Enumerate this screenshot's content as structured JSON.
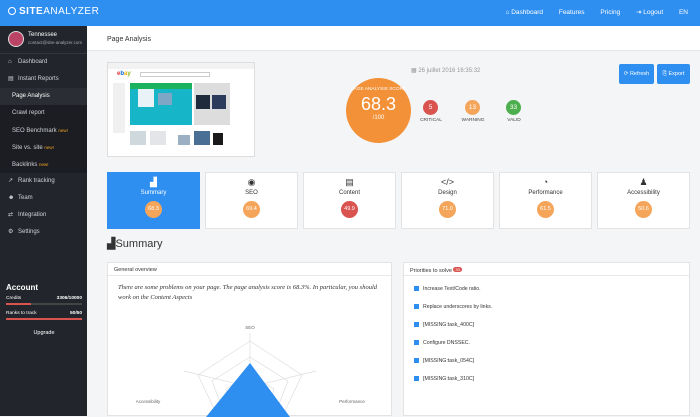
{
  "brand": {
    "site": "SITE",
    "analyzer": "ANALYZER"
  },
  "nav": {
    "dashboard": "Dashboard",
    "features": "Features",
    "pricing": "Pricing",
    "logout": "Logout",
    "lang": "EN"
  },
  "user": {
    "name": "Tennessee",
    "email": "contact@site-analyzer.com"
  },
  "sidebar": {
    "dashboard": "Dashboard",
    "instant": "Instant Reports",
    "subs": [
      "Page Analysis",
      "Crawl report",
      "SEO Benchmark",
      "Site vs. site",
      "Backlinks"
    ],
    "new": "new!",
    "rank": "Rank tracking",
    "team": "Team",
    "integration": "Integration",
    "settings": "Settings"
  },
  "account": {
    "title": "Account",
    "credits_label": "Credits",
    "credits_value": "3306/10000",
    "ranks_label": "Ranks to track",
    "ranks_value": "50/50",
    "credits_pct": 33,
    "ranks_pct": 100,
    "upgrade": "Upgrade"
  },
  "page_title": "Page Analysis",
  "analysis": {
    "date": "26 juillet 2016 16:35:32",
    "score_label": "PAGE ANALYSIS SCORE",
    "score": "68.3",
    "score_max": "/100",
    "critical": {
      "value": "5",
      "label": "CRITICAL"
    },
    "warning": {
      "value": "13",
      "label": "WARNING"
    },
    "valid": {
      "value": "33",
      "label": "VALID"
    }
  },
  "buttons": {
    "refresh": "Refresh",
    "export": "Export"
  },
  "categories": [
    {
      "label": "Summary",
      "score": "68.3",
      "icon": "chart-icon"
    },
    {
      "label": "SEO",
      "score": "69.4",
      "icon": "eye-icon"
    },
    {
      "label": "Content",
      "score": "49.9",
      "icon": "document-icon"
    },
    {
      "label": "Design",
      "score": "71.0",
      "icon": "code-icon"
    },
    {
      "label": "Performance",
      "score": "61.5",
      "icon": "gauge-icon"
    },
    {
      "label": "Accessibility",
      "score": "50.6",
      "icon": "user-icon"
    }
  ],
  "colors": {
    "accent": "#2f8ff0",
    "orange": "#f5a55a",
    "red": "#d9534f",
    "green": "#4cae4c"
  },
  "summary_title": "Summary",
  "overview": {
    "title": "General overview",
    "text": "There are some problems on your page. The page analysis score is 68.3%. In particular, you should work on the Content Aspects",
    "radar_labels": {
      "top": "SEO",
      "left": "Accessibility",
      "right": "Performance"
    }
  },
  "priorities": {
    "title": "Priorities to solve",
    "count": "33",
    "items": [
      "Increase Text/Code ratio.",
      "Replace underscores by links.",
      "[MISSING:task_400C]",
      "Configure DNSSEC.",
      "[MISSING:task_054C]",
      "[MISSING:task_310C]"
    ]
  }
}
